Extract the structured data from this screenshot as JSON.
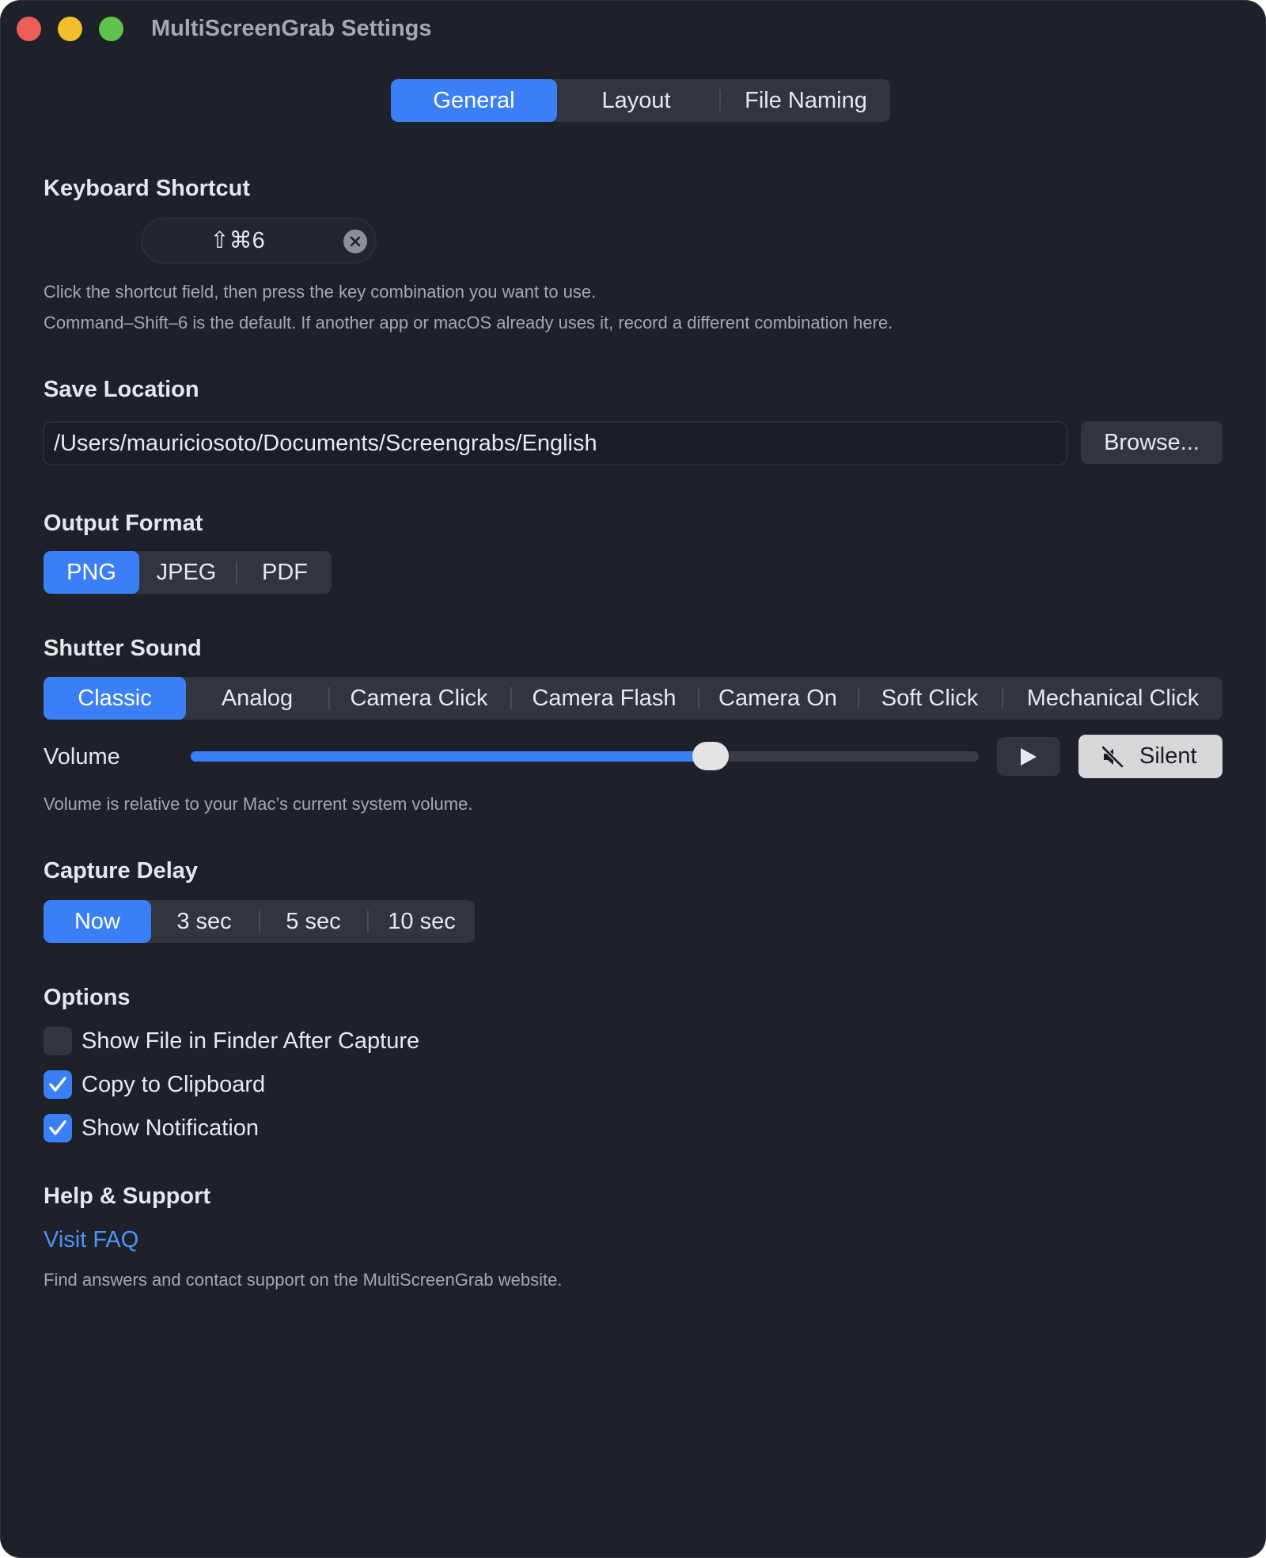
{
  "window": {
    "title": "MultiScreenGrab Settings"
  },
  "tabs": [
    {
      "label": "General",
      "active": true
    },
    {
      "label": "Layout",
      "active": false
    },
    {
      "label": "File Naming",
      "active": false
    }
  ],
  "keyboard_shortcut": {
    "heading": "Keyboard Shortcut",
    "value": "⇧⌘6",
    "help_line1": "Click the shortcut field, then press the key combination you want to use.",
    "help_line2": "Command–Shift–6 is the default. If another app or macOS already uses it, record a different combination here."
  },
  "save_location": {
    "heading": "Save Location",
    "path": "/Users/mauriciosoto/Documents/Screengrabs/English",
    "browse_label": "Browse..."
  },
  "output_format": {
    "heading": "Output Format",
    "options": [
      "PNG",
      "JPEG",
      "PDF"
    ],
    "selected": "PNG"
  },
  "shutter_sound": {
    "heading": "Shutter Sound",
    "options": [
      "Classic",
      "Analog",
      "Camera Click",
      "Camera Flash",
      "Camera On",
      "Soft Click",
      "Mechanical Click"
    ],
    "selected": "Classic",
    "volume_label": "Volume",
    "volume_fraction": 0.66,
    "silent_label": "Silent",
    "help": "Volume is relative to your Mac’s current system volume."
  },
  "capture_delay": {
    "heading": "Capture Delay",
    "options": [
      "Now",
      "3 sec",
      "5 sec",
      "10 sec"
    ],
    "selected": "Now"
  },
  "options": {
    "heading": "Options",
    "items": [
      {
        "label": "Show File in Finder After Capture",
        "checked": false
      },
      {
        "label": "Copy to Clipboard",
        "checked": true
      },
      {
        "label": "Show Notification",
        "checked": true
      }
    ]
  },
  "help_support": {
    "heading": "Help & Support",
    "link": "Visit FAQ",
    "help": "Find answers and contact support on the MultiScreenGrab website."
  },
  "colors": {
    "background": "#1f212a",
    "accent": "#3b7ff6",
    "link": "#4d93f8",
    "segment_bg": "#33353e"
  }
}
